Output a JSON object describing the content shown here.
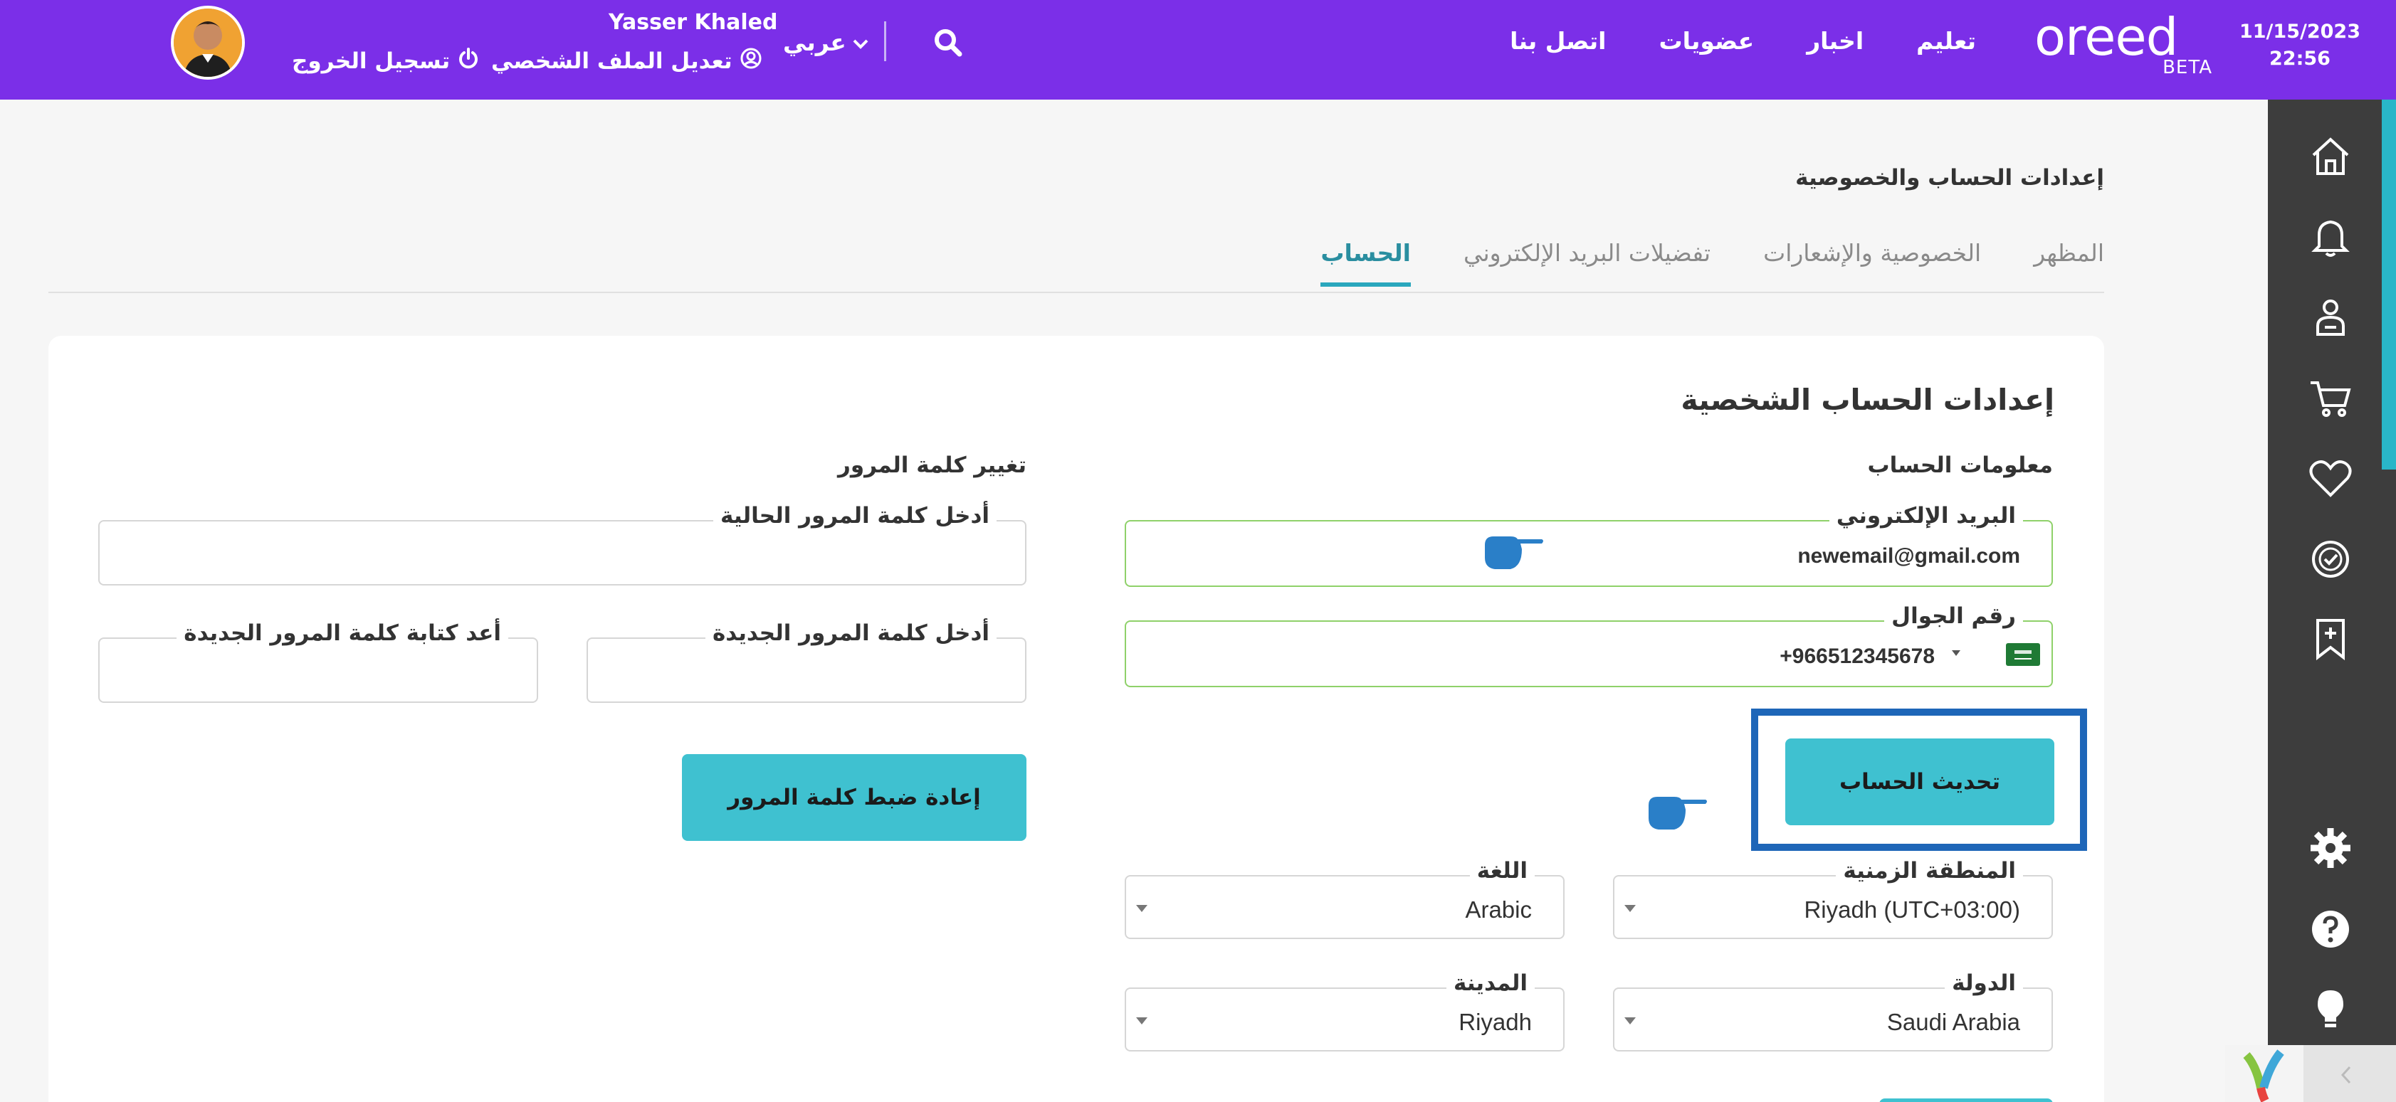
{
  "header": {
    "date": "11/15/2023",
    "time": "22:56",
    "logo_text": "oreed",
    "logo_badge": "BETA",
    "nav": [
      "تعليم",
      "اخبار",
      "عضويات",
      "اتصل بنا"
    ],
    "language": "عربي",
    "user_name": "Yasser Khaled",
    "profile_link": "تعديل الملف الشخصي",
    "logout_link": "تسجيل الخروج"
  },
  "page": {
    "title": "إعدادات الحساب والخصوصية",
    "tabs": [
      {
        "label": "الحساب",
        "active": true
      },
      {
        "label": "تفضيلات البريد الإلكتروني",
        "active": false
      },
      {
        "label": "الخصوصية والإشعارات",
        "active": false
      },
      {
        "label": "المظهر",
        "active": false
      }
    ]
  },
  "account": {
    "section_title": "إعدادات الحساب الشخصية",
    "info_title": "معلومات الحساب",
    "email_label": "البريد الإلكتروني",
    "email_value": "newemail@gmail.com",
    "phone_label": "رقم الجوال",
    "phone_value": "+966512345678",
    "update_button": "تحديث الحساب",
    "timezone_label": "المنطقة الزمنية",
    "timezone_value": "Riyadh (UTC+03:00)",
    "language_label": "اللغة",
    "language_value": "Arabic",
    "country_label": "الدولة",
    "country_value": "Saudi Arabia",
    "city_label": "المدينة",
    "city_value": "Riyadh"
  },
  "password": {
    "title": "تغيير كلمة المرور",
    "current_label": "أدخل كلمة المرور الحالية",
    "new_label": "أدخل كلمة المرور الجديدة",
    "confirm_label": "أعد كتابة كلمة المرور الجديدة",
    "reset_button": "إعادة ضبط كلمة المرور"
  },
  "colors": {
    "brand": "#7b2fe8",
    "accent": "#3fc1d0",
    "highlight": "#1e66b8",
    "sidebar": "#3d3d3d"
  },
  "sidebar_icons": [
    "home-icon",
    "bell-icon",
    "user-badge-icon",
    "cart-icon",
    "heart-icon",
    "check-badge-icon",
    "bookmark-plus-icon",
    "gear-icon",
    "help-icon",
    "lightbulb-icon"
  ]
}
